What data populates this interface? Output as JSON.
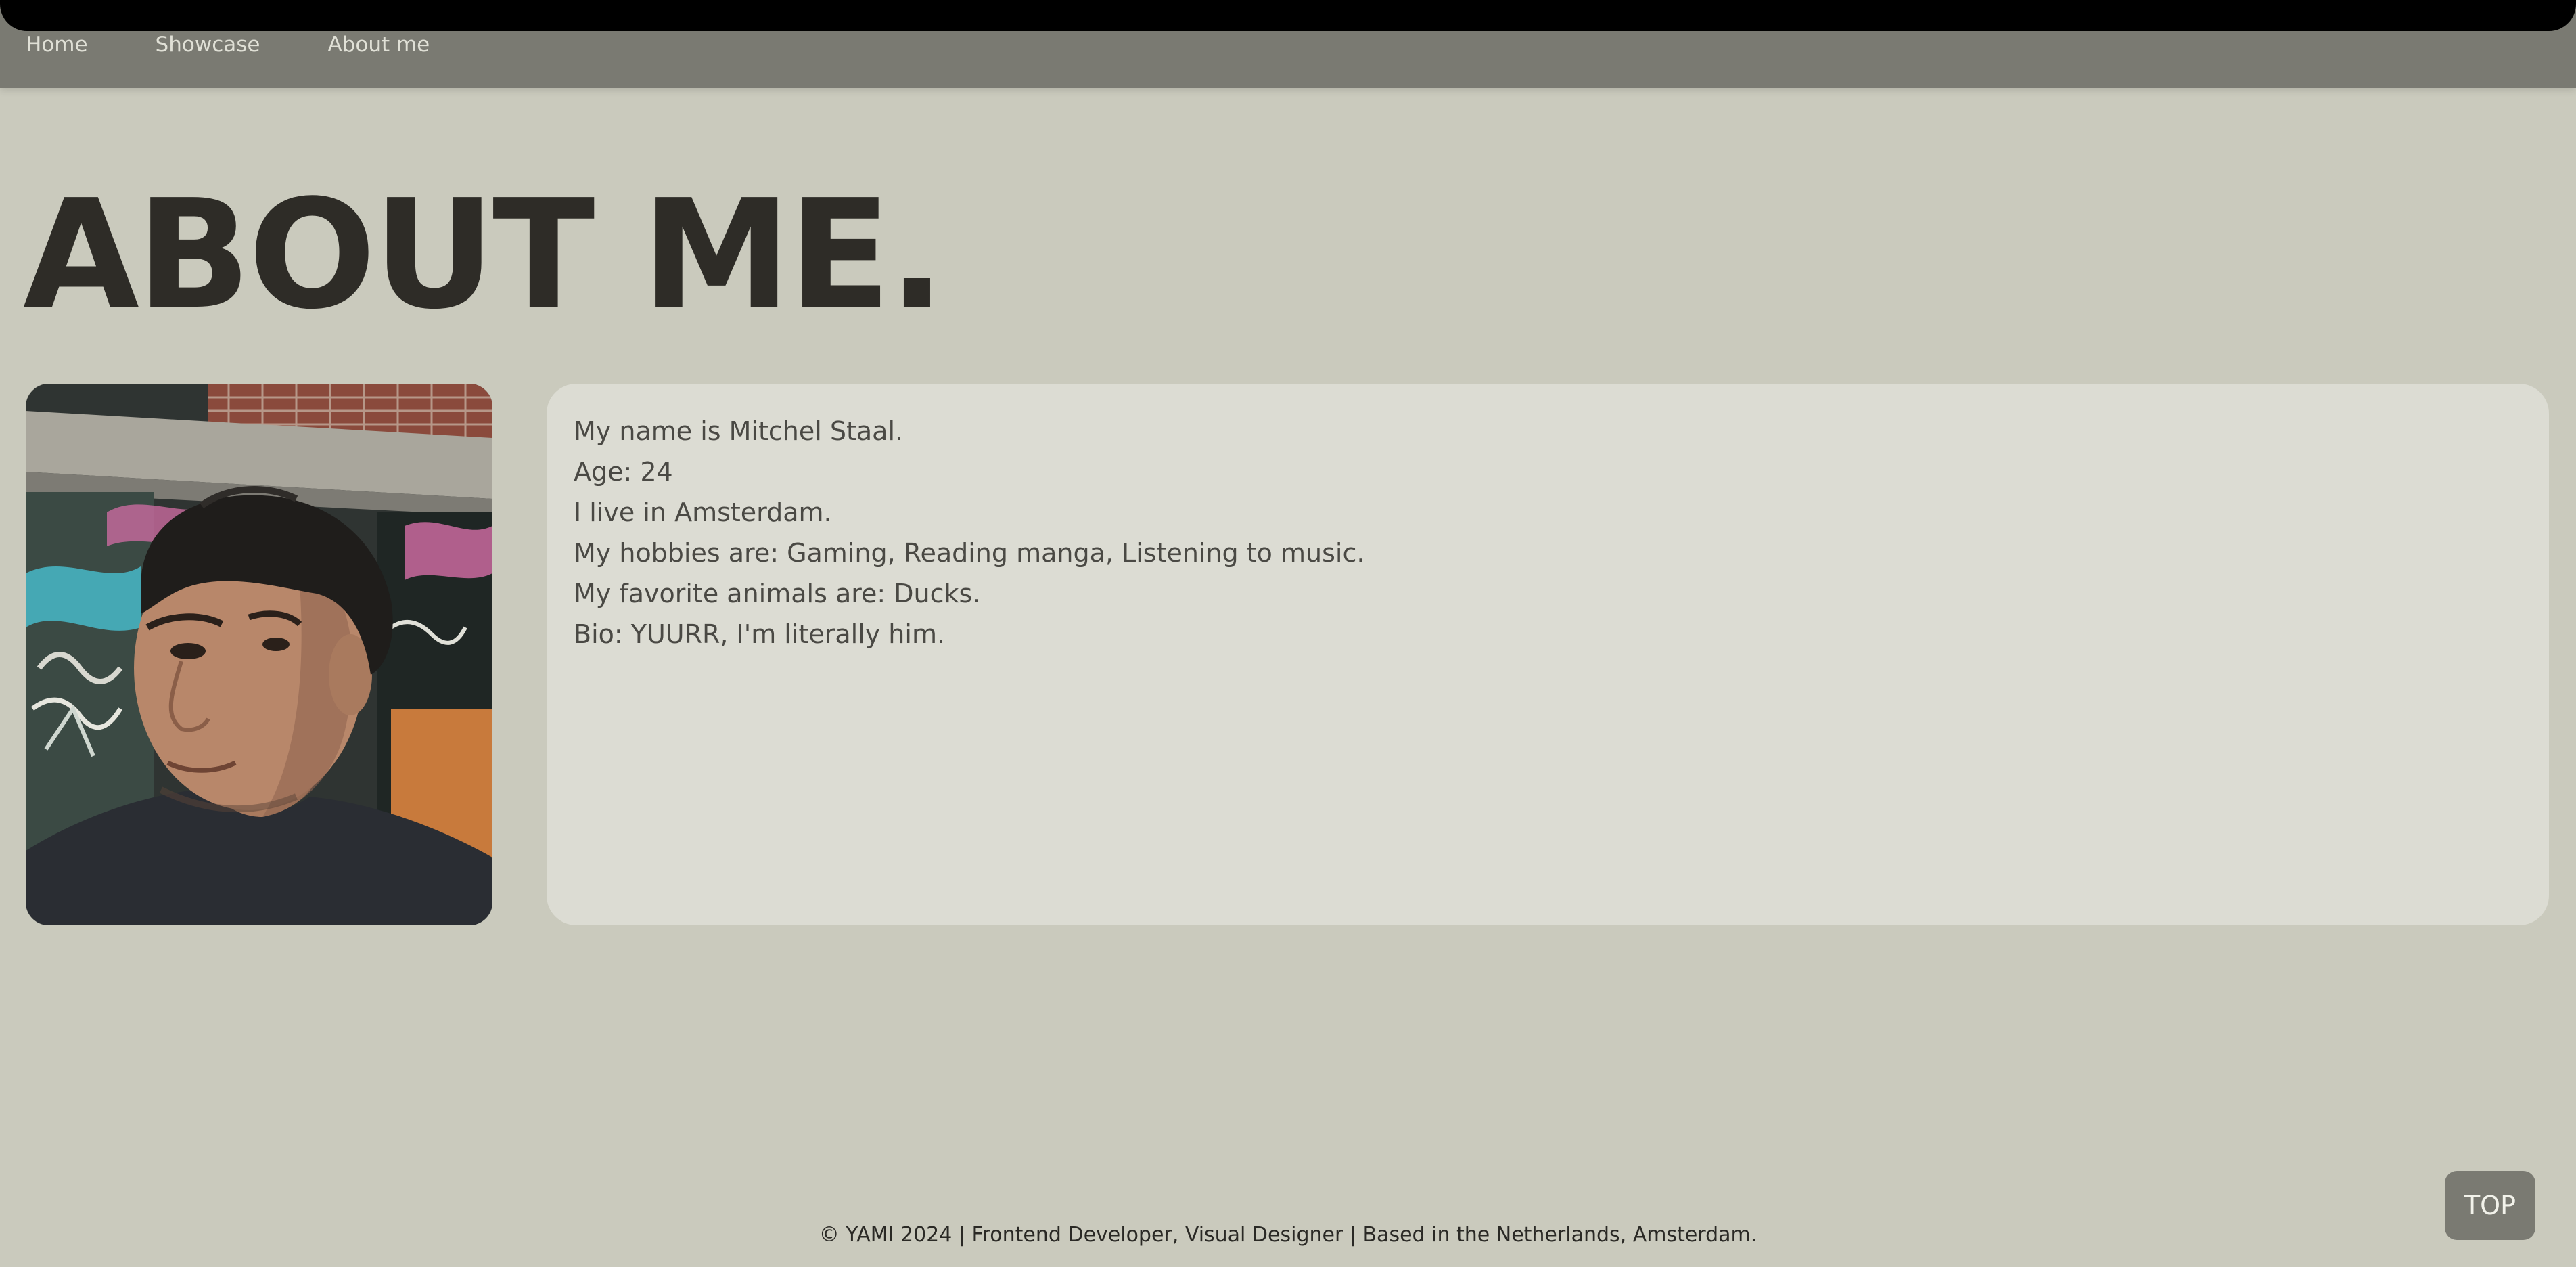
{
  "nav": {
    "items": [
      {
        "label": "Home"
      },
      {
        "label": "Showcase"
      },
      {
        "label": "About me"
      }
    ]
  },
  "page": {
    "title": "ABOUT ME."
  },
  "about": {
    "lines": [
      "My name is Mitchel Staal.",
      "Age: 24",
      "I live in Amsterdam.",
      "My hobbies are: Gaming, Reading manga, Listening to music.",
      "My favorite animals are: Ducks.",
      "Bio: YUURR, I'm literally him."
    ]
  },
  "footer": {
    "text": "© YAMI 2024 | Frontend Developer, Visual Designer | Based in the Netherlands, Amsterdam."
  },
  "top_button": {
    "label": "TOP"
  },
  "colors": {
    "background": "#cacabd",
    "navbar": "#7a7a72",
    "card": "#dcdcd3",
    "title": "#2e2c27"
  }
}
